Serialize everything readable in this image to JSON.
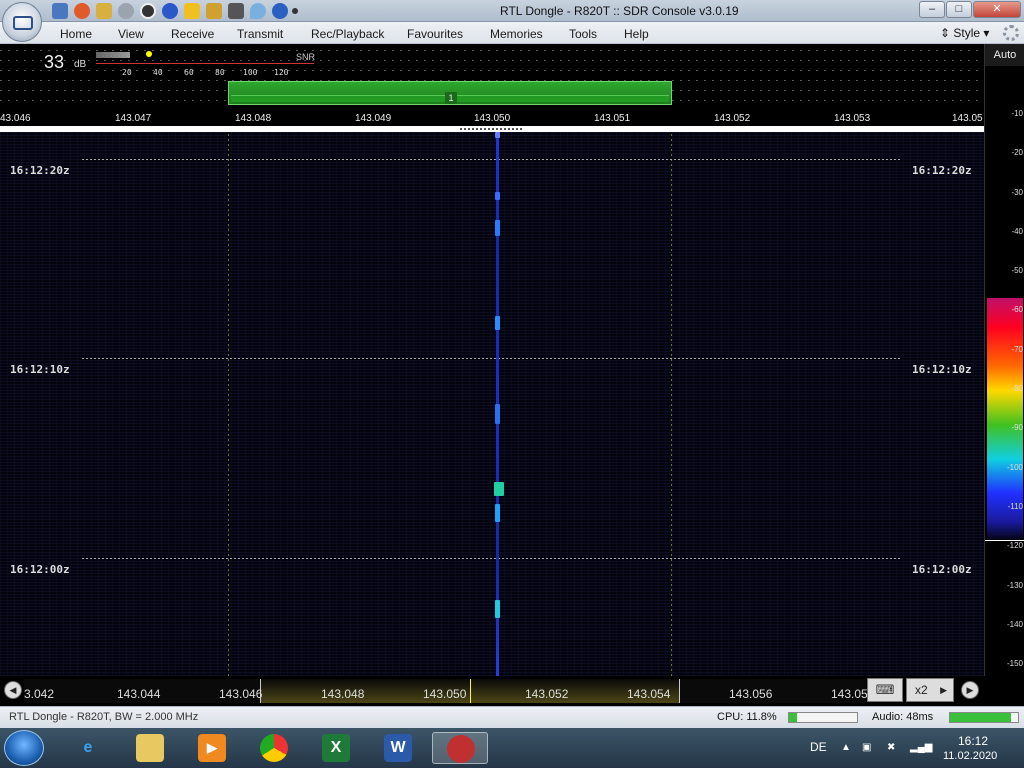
{
  "window": {
    "title": "RTL Dongle - R820T :: SDR Console v3.0.19"
  },
  "menu": {
    "items": [
      "Home",
      "View",
      "Receive",
      "Transmit",
      "Rec/Playback",
      "Favourites",
      "Memories",
      "Tools",
      "Help"
    ],
    "style_label": "Style"
  },
  "snr": {
    "value": "33",
    "unit": "dB",
    "label": "SNR",
    "ticks": [
      "20",
      "40",
      "60",
      "80",
      "100",
      "120"
    ]
  },
  "vfo": {
    "marker": "1"
  },
  "freq_scale": [
    "43.046",
    "143.047",
    "143.048",
    "143.049",
    "143.050",
    "143.051",
    "143.052",
    "143.053",
    "143.05"
  ],
  "waterfall": {
    "time_labels": [
      "16:12:20z",
      "16:12:10z",
      "16:12:00z"
    ]
  },
  "db_scale": {
    "auto_label": "Auto",
    "labels": [
      "-10",
      "-20",
      "-30",
      "-40",
      "-50",
      "-60",
      "-70",
      "-80",
      "-90",
      "-100",
      "-110",
      "-120",
      "-130",
      "-140",
      "-150"
    ]
  },
  "scroll_bar": {
    "frequencies": [
      "3.042",
      "143.044",
      "143.046",
      "143.048",
      "143.050",
      "143.052",
      "143.054",
      "143.056",
      "143.05"
    ],
    "zoom_label": "x2"
  },
  "status": {
    "device": "RTL Dongle - R820T, BW = 2.000 MHz",
    "cpu_label": "CPU: 11.8%",
    "cpu_fraction": 0.118,
    "audio_label": "Audio: 48ms",
    "audio_fraction": 0.9
  },
  "taskbar": {
    "language": "DE",
    "time": "16:12",
    "date": "11.02.2020"
  },
  "colors": {
    "waterfall_bg": "#04040f",
    "signal": "#2040ff",
    "vfo_band": "#2ea82e"
  }
}
